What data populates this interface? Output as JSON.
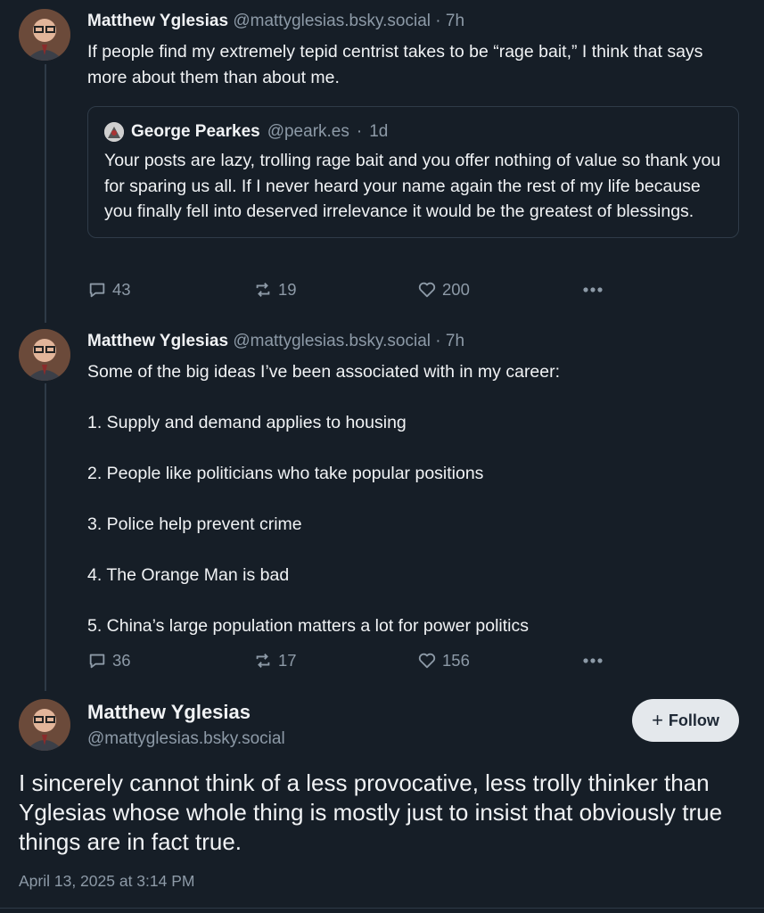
{
  "posts": [
    {
      "author": "Matthew Yglesias",
      "handle": "@mattyglesias.bsky.social",
      "separator": "·",
      "time": "7h",
      "text": "If people find my extremely tepid centrist takes to be “rage bait,” I think that says more about them than about me.",
      "quote": {
        "author": "George Pearkes",
        "handle": "@peark.es",
        "separator": "·",
        "time": "1d",
        "text": "Your posts are lazy, trolling rage bait and you offer nothing of value so thank you for sparing us all. If I never heard your name again the rest of my life because you finally fell into deserved irrelevance it would be the greatest of blessings."
      },
      "replies": "43",
      "reposts": "19",
      "likes": "200"
    },
    {
      "author": "Matthew Yglesias",
      "handle": "@mattyglesias.bsky.social",
      "separator": "·",
      "time": "7h",
      "lines": [
        "Some of the big ideas I’ve been associated with in my career:",
        "1. Supply and demand applies to housing",
        "2. People like politicians who take popular positions",
        "3. Police help prevent crime",
        "4. The Orange Man is bad",
        "5. China’s large population matters a lot for power politics"
      ],
      "replies": "36",
      "reposts": "17",
      "likes": "156"
    }
  ],
  "main_post": {
    "author": "Matthew Yglesias",
    "handle": "@mattyglesias.bsky.social",
    "follow_label": "Follow",
    "follow_icon": "+",
    "text": "I sincerely cannot think of a less provocative, less trolly thinker than Yglesias whose whole thing is mostly just to insist that obviously true things are in fact true.",
    "date": "April 13, 2025 at 3:14 PM"
  },
  "icons": {
    "reply": "reply-icon",
    "repost": "repost-icon",
    "like": "heart-icon",
    "more": "more-icon"
  },
  "colors": {
    "background": "#161e27",
    "text": "#f1f3f5",
    "muted": "#8d9aa7",
    "border": "#2f3b48",
    "follow_bg": "#e4e8ec"
  }
}
